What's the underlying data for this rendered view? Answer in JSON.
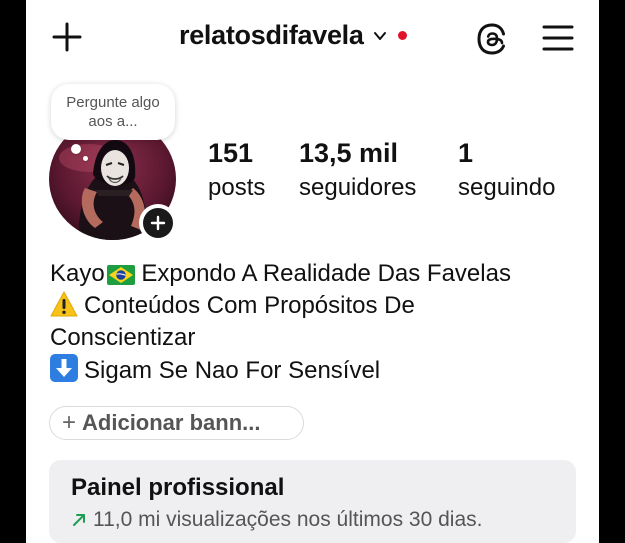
{
  "header": {
    "username": "relatosdifavela",
    "notification_dot_color": "#e0132b",
    "icons": [
      "plus-icon",
      "chevron-down-icon",
      "threads-icon",
      "hamburger-menu-icon"
    ]
  },
  "note": {
    "text": "Pergunte algo aos a..."
  },
  "stats": [
    {
      "value": "151",
      "label": "posts"
    },
    {
      "value": "13,5 mil",
      "label": "seguidores"
    },
    {
      "value": "1",
      "label": "seguindo"
    }
  ],
  "bio": {
    "line1": "Kayo",
    "line1_rest": " Expondo A Realidade Das Favelas",
    "line2": "Conteúdos Com Propósitos De",
    "line3": "Conscientizar",
    "line4": "Sigam Se Nao For Sensível"
  },
  "banner": {
    "label": "Adicionar bann..."
  },
  "panel": {
    "title": "Painel profissional",
    "subtitle": "11,0 mi visualizações nos últimos 30 dias.",
    "trend_color": "#1e9e54"
  }
}
